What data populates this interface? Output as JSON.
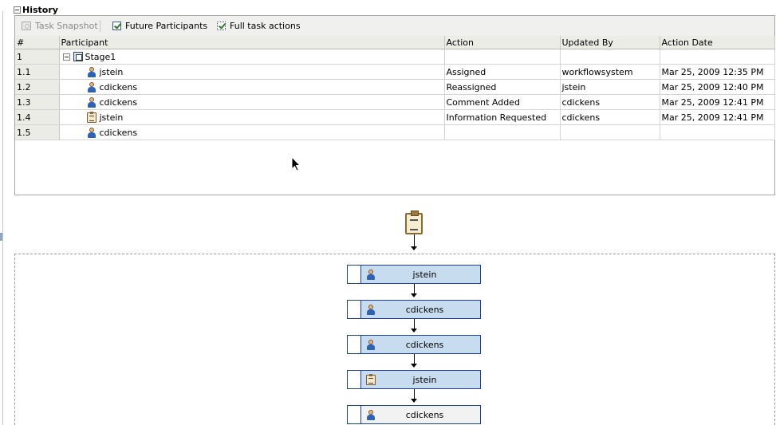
{
  "section": {
    "title": "History"
  },
  "toolbar": {
    "snapshot_label": "Task Snapshot",
    "future_label": "Future Participants",
    "full_actions_label": "Full task actions"
  },
  "table": {
    "headers": [
      "#",
      "Participant",
      "Action",
      "Updated By",
      "Action Date"
    ],
    "stage": {
      "num": "1",
      "name": "Stage1"
    },
    "rows": [
      {
        "num": "1.1",
        "participant": "jstein",
        "action": "Assigned",
        "updated_by": "workflowsystem",
        "date": "Mar 25, 2009 12:35 PM",
        "icon": "user-icon"
      },
      {
        "num": "1.2",
        "participant": "cdickens",
        "action": "Reassigned",
        "updated_by": "jstein",
        "date": "Mar 25, 2009 12:40 PM",
        "icon": "user-icon"
      },
      {
        "num": "1.3",
        "participant": "cdickens",
        "action": "Comment Added",
        "updated_by": "cdickens",
        "date": "Mar 25, 2009 12:41 PM",
        "icon": "user-icon"
      },
      {
        "num": "1.4",
        "participant": "jstein",
        "action": "Information Requested",
        "updated_by": "cdickens",
        "date": "Mar 25, 2009 12:41 PM",
        "icon": "clipboard-icon"
      },
      {
        "num": "1.5",
        "participant": "cdickens",
        "action": "",
        "updated_by": "",
        "date": "",
        "icon": "user-icon"
      }
    ]
  },
  "flow": {
    "nodes": [
      {
        "label": "jstein",
        "icon": "user-icon"
      },
      {
        "label": "cdickens",
        "icon": "user-icon"
      },
      {
        "label": "cdickens",
        "icon": "user-icon"
      },
      {
        "label": "jstein",
        "icon": "clipboard-icon"
      },
      {
        "label": "cdickens",
        "icon": "user-icon"
      }
    ]
  }
}
